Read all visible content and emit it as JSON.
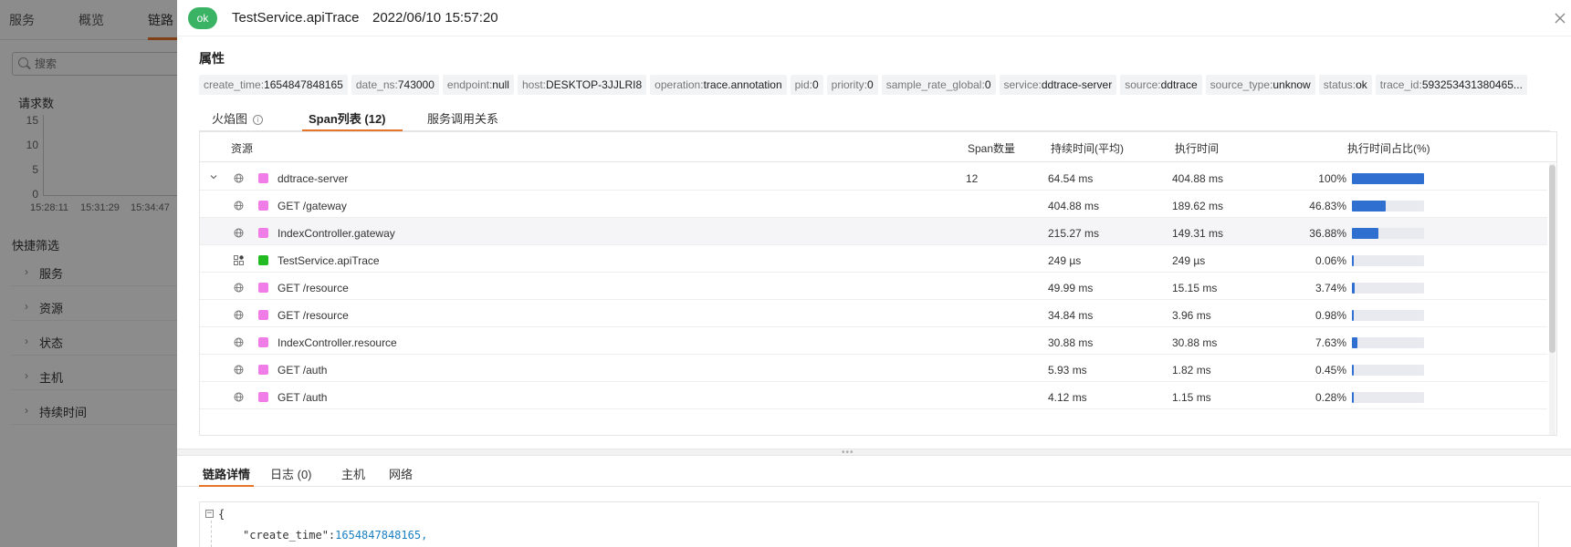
{
  "background": {
    "nav": [
      "服务",
      "概览",
      "链路"
    ],
    "search_placeholder": "搜索",
    "chart_title": "请求数",
    "y_ticks": [
      "15",
      "10",
      "5",
      "0"
    ],
    "x_ticks": [
      "15:28:11",
      "15:31:29",
      "15:34:47"
    ],
    "quick_filter_title": "快捷筛选",
    "filters": [
      "服务",
      "资源",
      "状态",
      "主机",
      "持续时间"
    ]
  },
  "drawer": {
    "status": "ok",
    "title": "TestService.apiTrace",
    "time": "2022/06/10 15:57:20",
    "attributes_title": "属性",
    "attributes": [
      {
        "k": "create_time",
        "v": "1654847848165"
      },
      {
        "k": "date_ns",
        "v": "743000"
      },
      {
        "k": "endpoint",
        "v": "null"
      },
      {
        "k": "host",
        "v": "DESKTOP-3JJLRI8"
      },
      {
        "k": "operation",
        "v": "trace.annotation"
      },
      {
        "k": "pid",
        "v": "0"
      },
      {
        "k": "priority",
        "v": "0"
      },
      {
        "k": "sample_rate_global",
        "v": "0"
      },
      {
        "k": "service",
        "v": "ddtrace-server"
      },
      {
        "k": "source",
        "v": "ddtrace"
      },
      {
        "k": "source_type",
        "v": "unknow"
      },
      {
        "k": "status",
        "v": "ok"
      },
      {
        "k": "trace_id",
        "v": "593253431380465..."
      }
    ],
    "tabs": [
      "火焰图",
      "Span列表 (12)",
      "服务调用关系"
    ],
    "columns": {
      "resource": "资源",
      "span_count": "Span数量",
      "avg_duration": "持续时间(平均)",
      "exec_time": "执行时间",
      "exec_pct": "执行时间占比(%)"
    },
    "rows": [
      {
        "resource": "ddtrace-server",
        "span_count": "12",
        "avg_duration": "64.54 ms",
        "exec_time": "404.88 ms",
        "pct": "100%",
        "pct_value": 100,
        "color": "#f07ce8",
        "icon": "globe-icon",
        "expandable": true
      },
      {
        "resource": "GET /gateway",
        "span_count": "",
        "avg_duration": "404.88 ms",
        "exec_time": "189.62 ms",
        "pct": "46.83%",
        "pct_value": 46.83,
        "color": "#f07ce8",
        "icon": "globe-icon",
        "expandable": false
      },
      {
        "resource": "IndexController.gateway",
        "span_count": "",
        "avg_duration": "215.27 ms",
        "exec_time": "149.31 ms",
        "pct": "36.88%",
        "pct_value": 36.88,
        "color": "#f07ce8",
        "icon": "globe-icon",
        "expandable": false
      },
      {
        "resource": "TestService.apiTrace",
        "span_count": "",
        "avg_duration": "249 µs",
        "exec_time": "249 µs",
        "pct": "0.06%",
        "pct_value": 0.06,
        "color": "#22bb22",
        "icon": "service-icon",
        "expandable": false
      },
      {
        "resource": "GET /resource",
        "span_count": "",
        "avg_duration": "49.99 ms",
        "exec_time": "15.15 ms",
        "pct": "3.74%",
        "pct_value": 3.74,
        "color": "#f07ce8",
        "icon": "globe-icon",
        "expandable": false
      },
      {
        "resource": "GET /resource",
        "span_count": "",
        "avg_duration": "34.84 ms",
        "exec_time": "3.96 ms",
        "pct": "0.98%",
        "pct_value": 0.98,
        "color": "#f07ce8",
        "icon": "globe-icon",
        "expandable": false
      },
      {
        "resource": "IndexController.resource",
        "span_count": "",
        "avg_duration": "30.88 ms",
        "exec_time": "30.88 ms",
        "pct": "7.63%",
        "pct_value": 7.63,
        "color": "#f07ce8",
        "icon": "globe-icon",
        "expandable": false
      },
      {
        "resource": "GET /auth",
        "span_count": "",
        "avg_duration": "5.93 ms",
        "exec_time": "1.82 ms",
        "pct": "0.45%",
        "pct_value": 0.45,
        "color": "#f07ce8",
        "icon": "globe-icon",
        "expandable": false
      },
      {
        "resource": "GET /auth",
        "span_count": "",
        "avg_duration": "4.12 ms",
        "exec_time": "1.15 ms",
        "pct": "0.28%",
        "pct_value": 0.28,
        "color": "#f07ce8",
        "icon": "globe-icon",
        "expandable": false
      }
    ],
    "bottom_tabs": [
      "链路详情",
      "日志 (0)",
      "主机",
      "网络"
    ],
    "json_brace": "{",
    "json_key": "\"create_time\":",
    "json_value": "1654847848165,"
  },
  "colors": {
    "accent": "#e8742a",
    "ok": "#3bb364",
    "bar": "#2f6fd0"
  }
}
